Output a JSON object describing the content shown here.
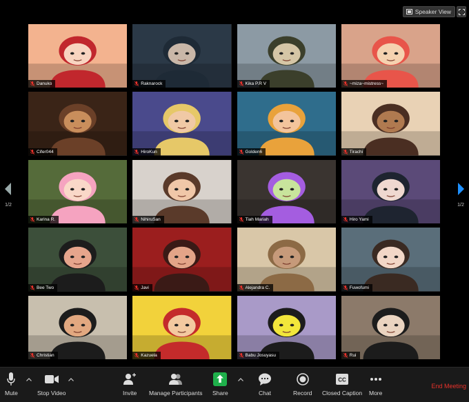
{
  "header": {
    "speaker_view_label": "Speaker View"
  },
  "pagination": {
    "left_page": "1/2",
    "right_page": "1/2"
  },
  "participants": [
    {
      "name": "Danuko",
      "bg": "#f3b38f",
      "accent": "#c1272d",
      "skin": "#f8d4c0"
    },
    {
      "name": "Raknarock",
      "bg": "#2b3947",
      "accent": "#1e2a36",
      "skin": "#c9b7a8"
    },
    {
      "name": "Kika P.R V",
      "bg": "#8c9aa4",
      "accent": "#3b3f2b",
      "skin": "#d5c6a6"
    },
    {
      "name": "~miza~mistress~",
      "bg": "#d9a38a",
      "accent": "#e8554a",
      "skin": "#f5d2b0"
    },
    {
      "name": "Cifer044",
      "bg": "#3a2417",
      "accent": "#6b4028",
      "skin": "#c98e5c"
    },
    {
      "name": "HiroKun",
      "bg": "#4a4a8c",
      "accent": "#e6c868",
      "skin": "#f0c9a5"
    },
    {
      "name": "Golden6",
      "bg": "#2f6d8c",
      "accent": "#e9a23b",
      "skin": "#f3c49c"
    },
    {
      "name": "Tirachi",
      "bg": "#e9d2b5",
      "accent": "#4a2e22",
      "skin": "#b07a50"
    },
    {
      "name": "Karina R.",
      "bg": "#556b3a",
      "accent": "#f5a3c0",
      "skin": "#f9d8c8"
    },
    {
      "name": "NihiruSan",
      "bg": "#d8d2cc",
      "accent": "#5a3a2a",
      "skin": "#f0c7a8"
    },
    {
      "name": "Tiah Mariah",
      "bg": "#3a3430",
      "accent": "#a45de0",
      "skin": "#c8e49c"
    },
    {
      "name": "Hiro Yami",
      "bg": "#5b4a78",
      "accent": "#1e2430",
      "skin": "#efd8d0"
    },
    {
      "name": "Bee Two",
      "bg": "#3c4f3a",
      "accent": "#1c1c1c",
      "skin": "#e6a58c"
    },
    {
      "name": "Javi",
      "bg": "#9b1e1e",
      "accent": "#3a1a16",
      "skin": "#e3a488"
    },
    {
      "name": "Alejandra C.",
      "bg": "#d9c7a8",
      "accent": "#8c6a45",
      "skin": "#c69a7a"
    },
    {
      "name": "Fuwofumi",
      "bg": "#5a6e7a",
      "accent": "#3a2a22",
      "skin": "#f2d7c7"
    },
    {
      "name": "Christian",
      "bg": "#c8bfae",
      "accent": "#1c1c1c",
      "skin": "#e2a880"
    },
    {
      "name": "Kazuela",
      "bg": "#f2d23b",
      "accent": "#c42b2b",
      "skin": "#f3c9a0"
    },
    {
      "name": "Babu Josuyasu",
      "bg": "#a99ac8",
      "accent": "#1c1c1c",
      "skin": "#f2e63b"
    },
    {
      "name": "Rui",
      "bg": "#8c7a6a",
      "accent": "#1c1c1c",
      "skin": "#ead4c0"
    }
  ],
  "toolbar": {
    "mute": "Mute",
    "stop_video": "Stop Video",
    "invite": "Invite",
    "manage_participants": "Manage Participants",
    "share": "Share",
    "chat": "Chat",
    "record": "Record",
    "closed_caption": "Closed Caption",
    "more": "More",
    "end_meeting": "End Meeting",
    "cc_glyph": "CC"
  },
  "colors": {
    "share_green": "#1fb04b",
    "end_red": "#e8322b",
    "nav_blue": "#1e90ff"
  }
}
